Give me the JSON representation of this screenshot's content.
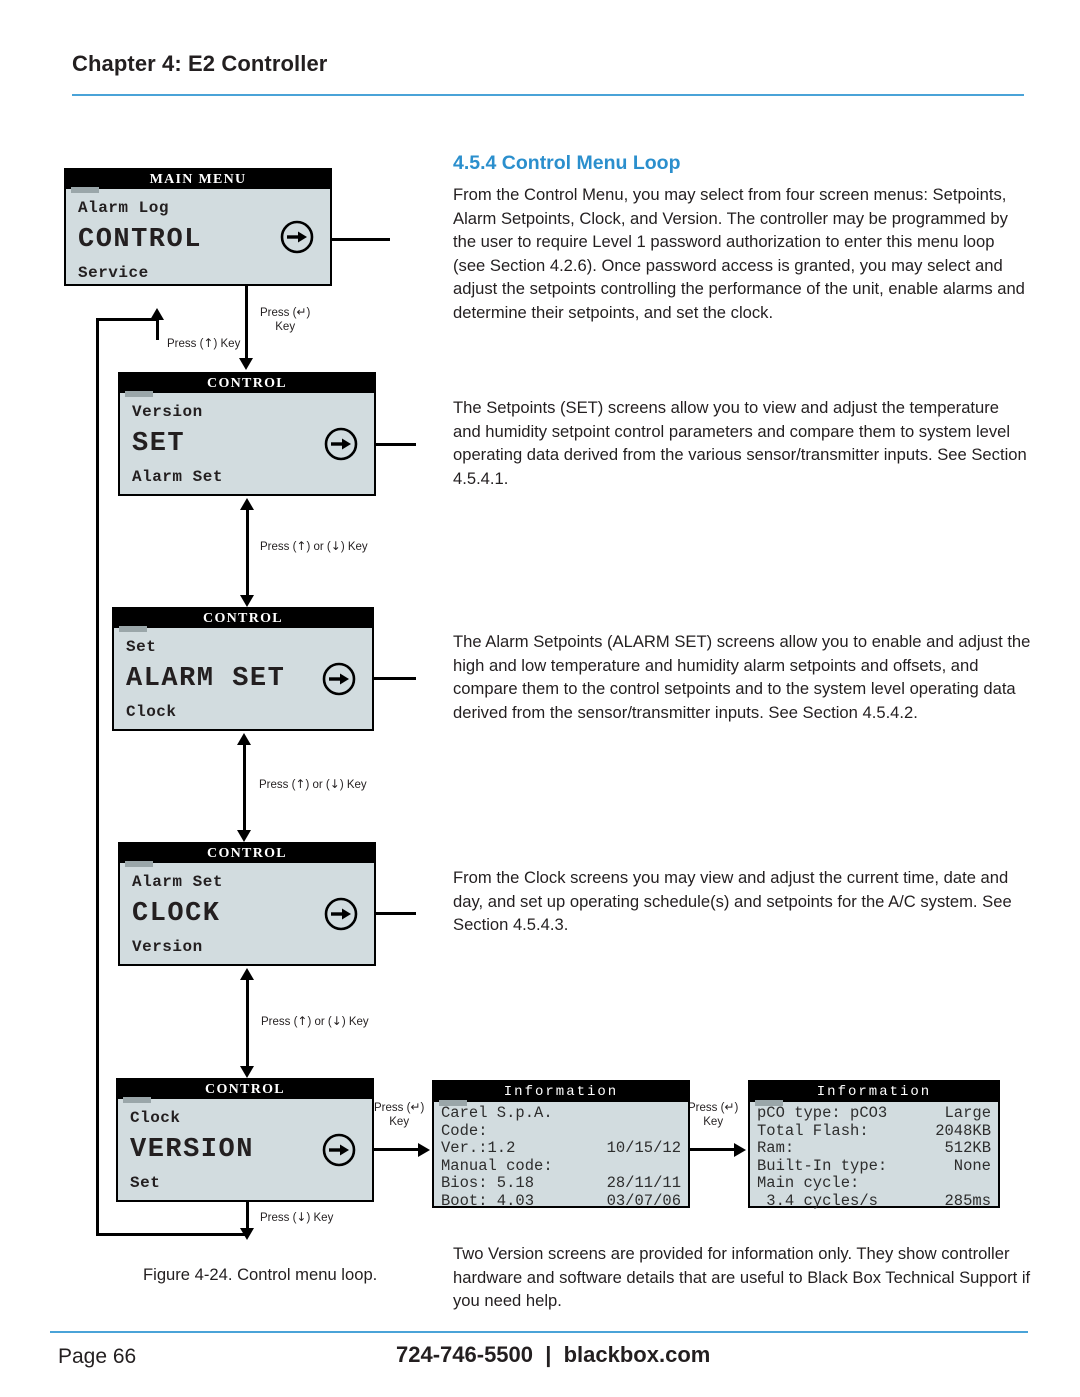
{
  "header": {
    "chapter_title": "Chapter 4: E2 Controller",
    "rule_color": "#4aa3d8"
  },
  "footer": {
    "page_number": "Page 66",
    "contact": "724-746-5500  |  blackbox.com"
  },
  "section": {
    "heading": "4.5.4 Control Menu Loop",
    "paragraphs": {
      "intro": "From the Control Menu, you may select from four screen menus: Setpoints, Alarm Setpoints, Clock, and Version. The controller may be programmed by the user to require Level 1 password authorization to enter this menu loop (see Section 4.2.6). Once password access is granted, you may select and adjust the setpoints controlling the performance of the unit, enable alarms and determine their setpoints, and set the clock.",
      "set": "The Setpoints (SET) screens allow you to view and adjust the temperature and humidity setpoint control parameters and compare them to system level operating data derived from the various sensor/transmitter inputs. See Section 4.5.4.1.",
      "alarm": "The Alarm Setpoints (ALARM SET) screens allow you to enable and adjust the high and low temperature and humidity alarm setpoints and offsets, and compare them to the control setpoints and to the system level operating data derived from the sensor/transmitter inputs. See Section 4.5.4.2.",
      "clock": "From the Clock screens you may view and adjust the current time, date and day, and set up operating schedule(s) and setpoints for the A/C system. See Section 4.5.4.3.",
      "version": "Two Version screens are provided for information only. They show controller hardware and software details that are useful to Black Box Technical Support if you need help."
    }
  },
  "figure": {
    "caption": "Figure 4-24. Control menu loop."
  },
  "lcd_panels": [
    {
      "id": "main",
      "title": "MAIN MENU",
      "line_above": "Alarm Log",
      "selection": "CONTROL",
      "line_below": "Service"
    },
    {
      "id": "set",
      "title": "CONTROL",
      "line_above": "Version",
      "selection": "SET",
      "line_below": "Alarm Set"
    },
    {
      "id": "alarm",
      "title": "CONTROL",
      "line_above": "Set",
      "selection": "ALARM SET",
      "line_below": "Clock"
    },
    {
      "id": "clock",
      "title": "CONTROL",
      "line_above": "Alarm Set",
      "selection": "CLOCK",
      "line_below": "Version"
    },
    {
      "id": "version",
      "title": "CONTROL",
      "line_above": "Clock",
      "selection": "VERSION",
      "line_below": "Set"
    }
  ],
  "info_screens": [
    {
      "title": "Information",
      "rows": [
        {
          "label": "Carel S.p.A.",
          "value": ""
        },
        {
          "label": "Code:",
          "value": ""
        },
        {
          "label": "Ver.:1.2",
          "value": "10/15/12"
        },
        {
          "label": "Manual code:",
          "value": ""
        },
        {
          "label": "Bios: 5.18",
          "value": "28/11/11"
        },
        {
          "label": "Boot: 4.03",
          "value": "03/07/06"
        }
      ]
    },
    {
      "title": "Information",
      "rows": [
        {
          "label": "pCO type: pCO3",
          "value": "Large"
        },
        {
          "label": "Total Flash:",
          "value": "2048KB"
        },
        {
          "label": "Ram:",
          "value": "512KB"
        },
        {
          "label": "Built-In type:",
          "value": "None"
        },
        {
          "label": "Main cycle:",
          "value": ""
        },
        {
          "label": " 3.4 cycles/s",
          "value": "285ms"
        }
      ]
    }
  ],
  "connector_labels": {
    "enter_from_main": "Press (↵)\nKey",
    "up_to_main": "Press (↑) Key",
    "up_or_down": "Press (↑) or (↓) Key",
    "down_from_version": "Press (↓) Key",
    "enter_to_info1": "Press (↵)\nKey",
    "enter_to_info2": "Press (↵)\nKey"
  },
  "colors": {
    "lcd_background": "#d2dcdf",
    "lcd_title_bar": "#000000",
    "heading": "#2b8fcd"
  }
}
